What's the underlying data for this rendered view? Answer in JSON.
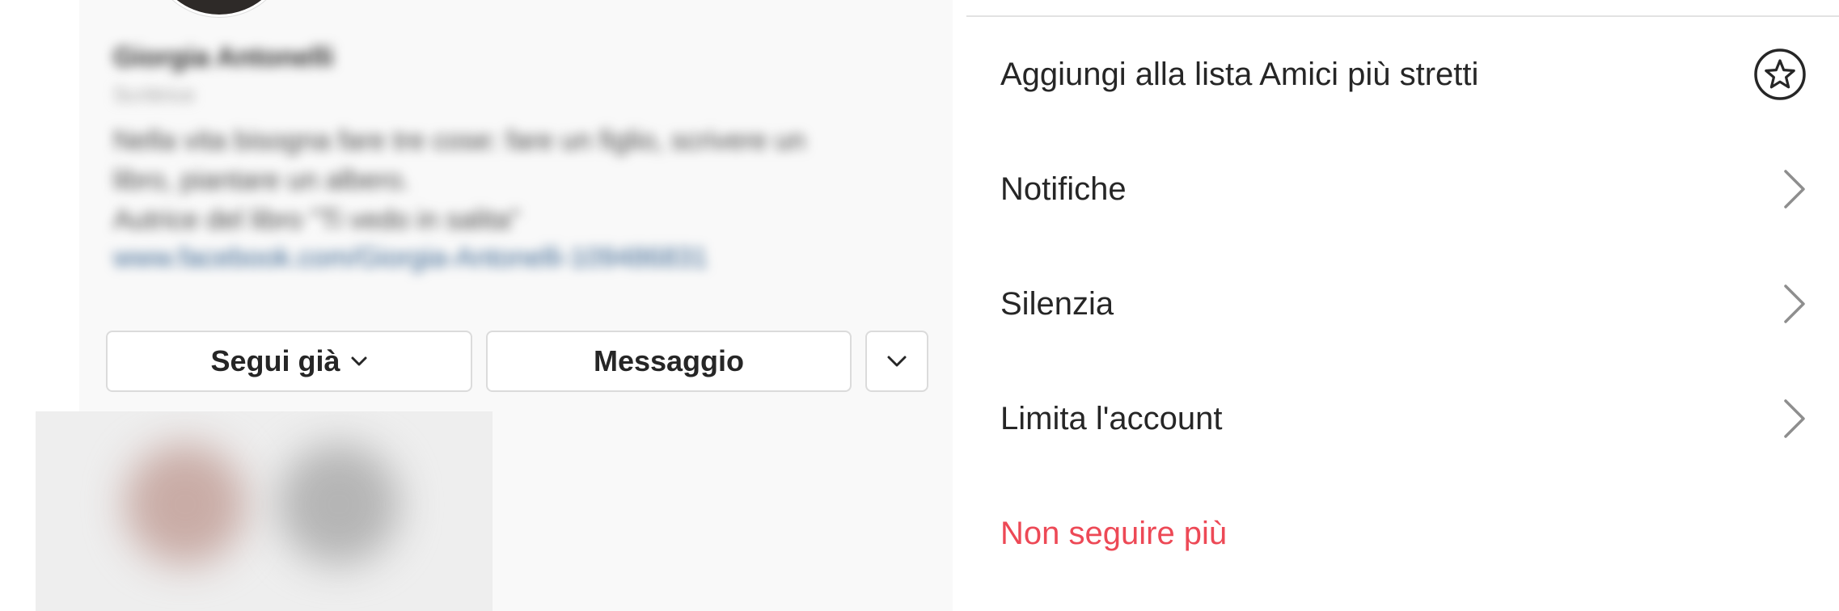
{
  "profile": {
    "name": "Giorgia Antonelli",
    "category": "Scrittrice",
    "bio_lines": [
      "Nella vita bisogna fare tre cose: fare un figlio, scrivere un",
      "libro, piantare un albero.",
      "Autrice del libro \"Ti vedo in salita\""
    ],
    "link": "www.facebook.com/Giorgia-Antonelli-109486831"
  },
  "actions": {
    "follow_label": "Segui già",
    "message_label": "Messaggio"
  },
  "sheet": {
    "items": [
      {
        "label": "Aggiungi alla lista Amici più stretti",
        "icon": "star-circle-icon"
      },
      {
        "label": "Notifiche",
        "icon": "chevron-right-icon"
      },
      {
        "label": "Silenzia",
        "icon": "chevron-right-icon"
      },
      {
        "label": "Limita l'account",
        "icon": "chevron-right-icon"
      },
      {
        "label": "Non seguire più",
        "color": "#ed4956"
      }
    ]
  },
  "colors": {
    "destructive": "#ed4956",
    "text": "#262626",
    "border": "#dbdbdb"
  }
}
